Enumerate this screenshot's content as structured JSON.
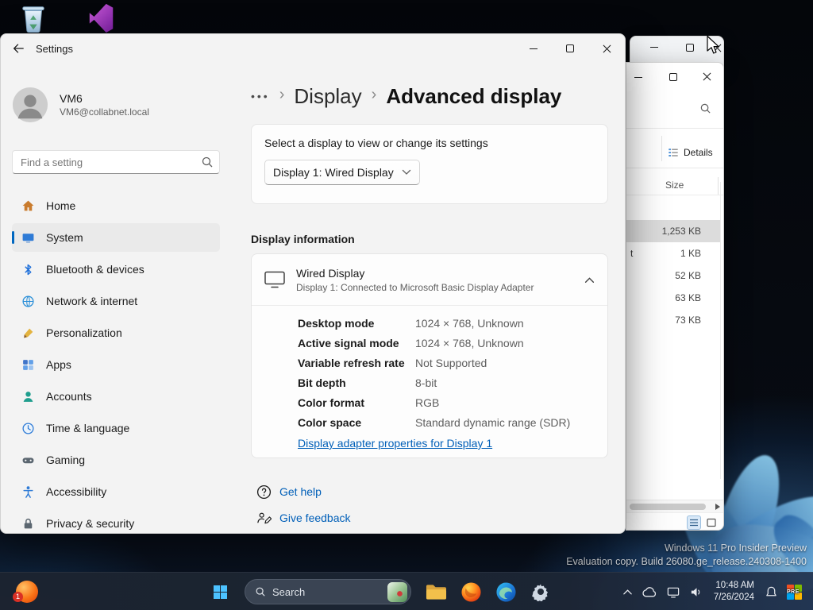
{
  "settings": {
    "window_title": "Settings",
    "user": {
      "name": "VM6",
      "email": "VM6@collabnet.local"
    },
    "search_placeholder": "Find a setting",
    "sidebar": [
      {
        "label": "Home"
      },
      {
        "label": "System"
      },
      {
        "label": "Bluetooth & devices"
      },
      {
        "label": "Network & internet"
      },
      {
        "label": "Personalization"
      },
      {
        "label": "Apps"
      },
      {
        "label": "Accounts"
      },
      {
        "label": "Time & language"
      },
      {
        "label": "Gaming"
      },
      {
        "label": "Accessibility"
      },
      {
        "label": "Privacy & security"
      }
    ],
    "breadcrumb": {
      "overflow": "•••",
      "sep": "›",
      "parent": "Display",
      "current": "Advanced display"
    },
    "display_select": {
      "label": "Select a display to view or change its settings",
      "value": "Display 1: Wired Display"
    },
    "section_title": "Display information",
    "display_info": {
      "title": "Wired Display",
      "subtitle": "Display 1: Connected to Microsoft Basic Display Adapter",
      "rows": [
        {
          "label": "Desktop mode",
          "value": "1024 × 768, Unknown"
        },
        {
          "label": "Active signal mode",
          "value": "1024 × 768, Unknown"
        },
        {
          "label": "Variable refresh rate",
          "value": "Not Supported"
        },
        {
          "label": "Bit depth",
          "value": "8-bit"
        },
        {
          "label": "Color format",
          "value": "RGB"
        },
        {
          "label": "Color space",
          "value": "Standard dynamic range (SDR)"
        }
      ],
      "adapter_link": "Display adapter properties for Display 1"
    },
    "help_link": "Get help",
    "feedback_link": "Give feedback"
  },
  "explorer": {
    "details_label": "Details",
    "size_header": "Size",
    "rows": [
      {
        "size": "1,253 KB"
      },
      {
        "size": "1 KB",
        "name_fragment": "t"
      },
      {
        "size": "52 KB"
      },
      {
        "size": "63 KB"
      },
      {
        "size": "73 KB"
      }
    ]
  },
  "watermark": {
    "line1": "Windows 11 Pro Insider Preview",
    "line2": "Evaluation copy. Build 26080.ge_release.240308-1400"
  },
  "taskbar": {
    "search_label": "Search",
    "time": "10:48 AM",
    "date": "7/26/2024",
    "insider_badge": "PRE",
    "notification_badge": "1"
  },
  "colors": {
    "accent": "#0067c0",
    "link": "#005fb8"
  }
}
